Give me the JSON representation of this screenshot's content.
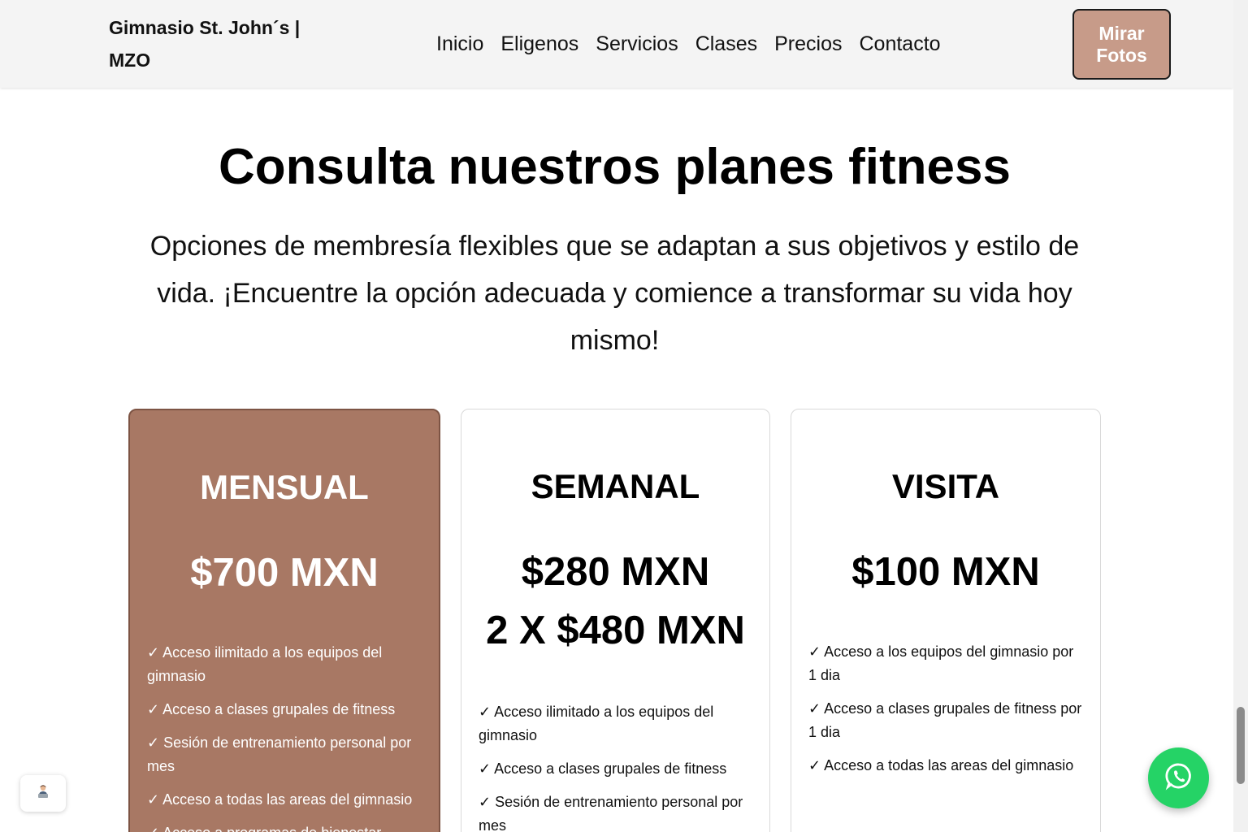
{
  "header": {
    "brand": "Gimnasio St. John´s | MZO",
    "nav": [
      "Inicio",
      "Eligenos",
      "Servicios",
      "Clases",
      "Precios",
      "Contacto"
    ],
    "cta_label": "Mirar Fotos"
  },
  "hero": {
    "title": "Consulta nuestros planes fitness",
    "subtitle": "Opciones de membresía flexibles que se adaptan a sus objetivos y estilo de vida. ¡Encuentre la opción adecuada y comience a transformar su vida hoy mismo!"
  },
  "plans": [
    {
      "name": "MENSUAL",
      "prices": [
        "$700 MXN"
      ],
      "features": [
        "✓ Acceso ilimitado a los equipos del gimnasio",
        "✓ Acceso a clases grupales de fitness",
        "✓ Sesión de entrenamiento personal por mes",
        "✓ Acceso a todas las areas del gimnasio",
        "✓ Acceso a programas de bienestar"
      ]
    },
    {
      "name": "SEMANAL",
      "prices": [
        "$280 MXN",
        "2 X $480 MXN"
      ],
      "features": [
        "✓ Acceso ilimitado a los equipos del gimnasio",
        "✓ Acceso a clases grupales de fitness",
        "✓ Sesión de entrenamiento personal por mes"
      ]
    },
    {
      "name": "VISITA",
      "prices": [
        "$100 MXN"
      ],
      "features": [
        "✓ Acceso a los equipos del gimnasio por 1 dia",
        "✓ Acceso a clases grupales de fitness por 1 dia",
        "✓ Acceso a todas las areas del gimnasio"
      ]
    }
  ],
  "colors": {
    "featured_card": "#a87864",
    "cta_button": "#c79b89",
    "whatsapp": "#25d366",
    "header_bg": "#f4f4f4"
  },
  "icons": {
    "floating_badge": "person-at-laptop-icon",
    "chat": "whatsapp-icon"
  }
}
